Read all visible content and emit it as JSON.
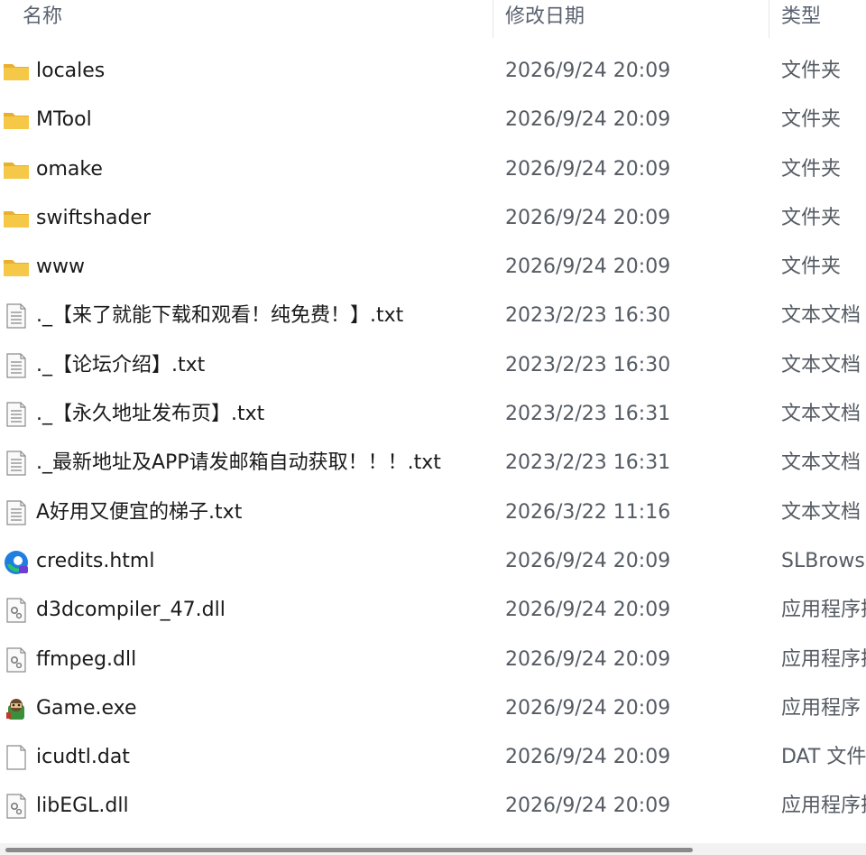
{
  "columns": {
    "name": "名称",
    "date": "修改日期",
    "type": "类型"
  },
  "files": [
    {
      "name": "locales",
      "date": "2026/9/24 20:09",
      "type": "文件夹",
      "icon": "folder-icon"
    },
    {
      "name": "MTool",
      "date": "2026/9/24 20:09",
      "type": "文件夹",
      "icon": "folder-icon"
    },
    {
      "name": "omake",
      "date": "2026/9/24 20:09",
      "type": "文件夹",
      "icon": "folder-icon"
    },
    {
      "name": "swiftshader",
      "date": "2026/9/24 20:09",
      "type": "文件夹",
      "icon": "folder-icon"
    },
    {
      "name": "www",
      "date": "2026/9/24 20:09",
      "type": "文件夹",
      "icon": "folder-icon"
    },
    {
      "name": "._【来了就能下载和观看！纯免费！】.txt",
      "date": "2023/2/23 16:30",
      "type": "文本文档",
      "icon": "text-document-icon"
    },
    {
      "name": "._【论坛介绍】.txt",
      "date": "2023/2/23 16:30",
      "type": "文本文档",
      "icon": "text-document-icon"
    },
    {
      "name": "._【永久地址发布页】.txt",
      "date": "2023/2/23 16:31",
      "type": "文本文档",
      "icon": "text-document-icon"
    },
    {
      "name": "._最新地址及APP请发邮箱自动获取！！！.txt",
      "date": "2023/2/23 16:31",
      "type": "文本文档",
      "icon": "text-document-icon"
    },
    {
      "name": "A好用又便宜的梯子.txt",
      "date": "2026/3/22 11:16",
      "type": "文本文档",
      "icon": "text-document-icon"
    },
    {
      "name": "credits.html",
      "date": "2026/9/24 20:09",
      "type": "SLBrowser",
      "icon": "browser-icon"
    },
    {
      "name": "d3dcompiler_47.dll",
      "date": "2026/9/24 20:09",
      "type": "应用程序扩展",
      "icon": "dll-file-icon"
    },
    {
      "name": "ffmpeg.dll",
      "date": "2026/9/24 20:09",
      "type": "应用程序扩展",
      "icon": "dll-file-icon"
    },
    {
      "name": "Game.exe",
      "date": "2026/9/24 20:09",
      "type": "应用程序",
      "icon": "game-app-icon"
    },
    {
      "name": "icudtl.dat",
      "date": "2026/9/24 20:09",
      "type": "DAT 文件",
      "icon": "blank-file-icon"
    },
    {
      "name": "libEGL.dll",
      "date": "2026/9/24 20:09",
      "type": "应用程序扩展",
      "icon": "dll-file-icon"
    }
  ],
  "colors": {
    "folder": "#f4c542",
    "text": "#1a1a1a",
    "secondary_text": "#555b63",
    "scroll_thumb": "#8a8a8a"
  }
}
